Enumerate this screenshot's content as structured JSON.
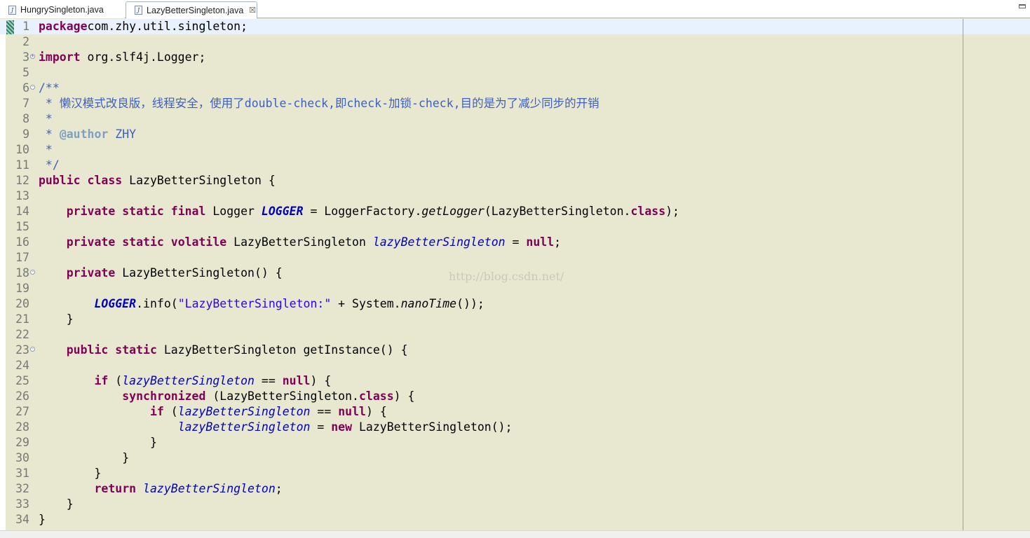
{
  "tabs": [
    {
      "label": "HungrySingleton.java",
      "active": false
    },
    {
      "label": "LazyBetterSingleton.java",
      "active": true
    }
  ],
  "tab_close_glyph": "☒",
  "watermark": "http://blog.csdn.net/",
  "colors": {
    "editor_bg": "#e8e8d0",
    "current_line": "#e8f2fe",
    "keyword": "#7f0055",
    "comment": "#3f5fbf",
    "string": "#2a00ff",
    "field": "#0000c0"
  },
  "lines": [
    {
      "n": "1",
      "fold": "",
      "tokens": [
        [
          "kw",
          "package"
        ],
        [
          "",
          "com.zhy.util.singleton;"
        ]
      ]
    },
    {
      "n": "2",
      "fold": "",
      "tokens": []
    },
    {
      "n": "3",
      "fold": "+",
      "tokens": [
        [
          "kw",
          "import"
        ],
        [
          "",
          " org.slf4j.Logger;"
        ]
      ]
    },
    {
      "n": "5",
      "fold": "",
      "tokens": []
    },
    {
      "n": "6",
      "fold": "-",
      "tokens": [
        [
          "cm",
          "/**"
        ]
      ]
    },
    {
      "n": "7",
      "fold": "",
      "tokens": [
        [
          "cm",
          " * 懒汉模式改良版，线程安全，使用了double-check,即check-加锁-check,目的是为了减少同步的开销"
        ]
      ]
    },
    {
      "n": "8",
      "fold": "",
      "tokens": [
        [
          "cm",
          " *"
        ]
      ]
    },
    {
      "n": "9",
      "fold": "",
      "tokens": [
        [
          "cm",
          " * "
        ],
        [
          "tag",
          "@author"
        ],
        [
          "cm",
          " ZHY"
        ]
      ]
    },
    {
      "n": "10",
      "fold": "",
      "tokens": [
        [
          "cm",
          " *"
        ]
      ]
    },
    {
      "n": "11",
      "fold": "",
      "tokens": [
        [
          "cm",
          " */"
        ]
      ]
    },
    {
      "n": "12",
      "fold": "",
      "tokens": [
        [
          "kw",
          "public class"
        ],
        [
          "",
          " LazyBetterSingleton {"
        ]
      ]
    },
    {
      "n": "13",
      "fold": "",
      "tokens": []
    },
    {
      "n": "14",
      "fold": "",
      "tokens": [
        [
          "",
          "    "
        ],
        [
          "kw",
          "private static final"
        ],
        [
          "",
          " Logger "
        ],
        [
          "sfield",
          "LOGGER"
        ],
        [
          "",
          " = LoggerFactory."
        ],
        [
          "smethod",
          "getLogger"
        ],
        [
          "",
          "(LazyBetterSingleton."
        ],
        [
          "kw",
          "class"
        ],
        [
          "",
          ");"
        ]
      ]
    },
    {
      "n": "15",
      "fold": "",
      "tokens": []
    },
    {
      "n": "16",
      "fold": "",
      "tokens": [
        [
          "",
          "    "
        ],
        [
          "kw",
          "private static volatile"
        ],
        [
          "",
          " LazyBetterSingleton "
        ],
        [
          "field",
          "lazyBetterSingleton"
        ],
        [
          "",
          " = "
        ],
        [
          "kw",
          "null"
        ],
        [
          "",
          ";"
        ]
      ]
    },
    {
      "n": "17",
      "fold": "",
      "tokens": []
    },
    {
      "n": "18",
      "fold": "-",
      "tokens": [
        [
          "",
          "    "
        ],
        [
          "kw",
          "private"
        ],
        [
          "",
          " LazyBetterSingleton() {"
        ]
      ]
    },
    {
      "n": "19",
      "fold": "",
      "tokens": []
    },
    {
      "n": "20",
      "fold": "",
      "tokens": [
        [
          "",
          "        "
        ],
        [
          "sfield",
          "LOGGER"
        ],
        [
          "",
          ".info("
        ],
        [
          "str",
          "\"LazyBetterSingleton:\""
        ],
        [
          "",
          " + System."
        ],
        [
          "smethod",
          "nanoTime"
        ],
        [
          "",
          "());"
        ]
      ]
    },
    {
      "n": "21",
      "fold": "",
      "tokens": [
        [
          "",
          "    }"
        ]
      ]
    },
    {
      "n": "22",
      "fold": "",
      "tokens": []
    },
    {
      "n": "23",
      "fold": "-",
      "tokens": [
        [
          "",
          "    "
        ],
        [
          "kw",
          "public static"
        ],
        [
          "",
          " LazyBetterSingleton getInstance() {"
        ]
      ]
    },
    {
      "n": "24",
      "fold": "",
      "tokens": []
    },
    {
      "n": "25",
      "fold": "",
      "tokens": [
        [
          "",
          "        "
        ],
        [
          "kw",
          "if"
        ],
        [
          "",
          " ("
        ],
        [
          "field",
          "lazyBetterSingleton"
        ],
        [
          "",
          " == "
        ],
        [
          "kw",
          "null"
        ],
        [
          "",
          ") {"
        ]
      ]
    },
    {
      "n": "26",
      "fold": "",
      "tokens": [
        [
          "",
          "            "
        ],
        [
          "kw",
          "synchronized"
        ],
        [
          "",
          " (LazyBetterSingleton."
        ],
        [
          "kw",
          "class"
        ],
        [
          "",
          ") {"
        ]
      ]
    },
    {
      "n": "27",
      "fold": "",
      "tokens": [
        [
          "",
          "                "
        ],
        [
          "kw",
          "if"
        ],
        [
          "",
          " ("
        ],
        [
          "field",
          "lazyBetterSingleton"
        ],
        [
          "",
          " == "
        ],
        [
          "kw",
          "null"
        ],
        [
          "",
          ") {"
        ]
      ]
    },
    {
      "n": "28",
      "fold": "",
      "tokens": [
        [
          "",
          "                    "
        ],
        [
          "field",
          "lazyBetterSingleton"
        ],
        [
          "",
          " = "
        ],
        [
          "kw",
          "new"
        ],
        [
          "",
          " LazyBetterSingleton();"
        ]
      ]
    },
    {
      "n": "29",
      "fold": "",
      "tokens": [
        [
          "",
          "                }"
        ]
      ]
    },
    {
      "n": "30",
      "fold": "",
      "tokens": [
        [
          "",
          "            }"
        ]
      ]
    },
    {
      "n": "31",
      "fold": "",
      "tokens": [
        [
          "",
          "        }"
        ]
      ]
    },
    {
      "n": "32",
      "fold": "",
      "tokens": [
        [
          "",
          "        "
        ],
        [
          "kw",
          "return"
        ],
        [
          "",
          " "
        ],
        [
          "field",
          "lazyBetterSingleton"
        ],
        [
          "",
          ";"
        ]
      ]
    },
    {
      "n": "33",
      "fold": "",
      "tokens": [
        [
          "",
          "    }"
        ]
      ]
    },
    {
      "n": "34",
      "fold": "",
      "tokens": [
        [
          "",
          "}"
        ]
      ]
    }
  ]
}
